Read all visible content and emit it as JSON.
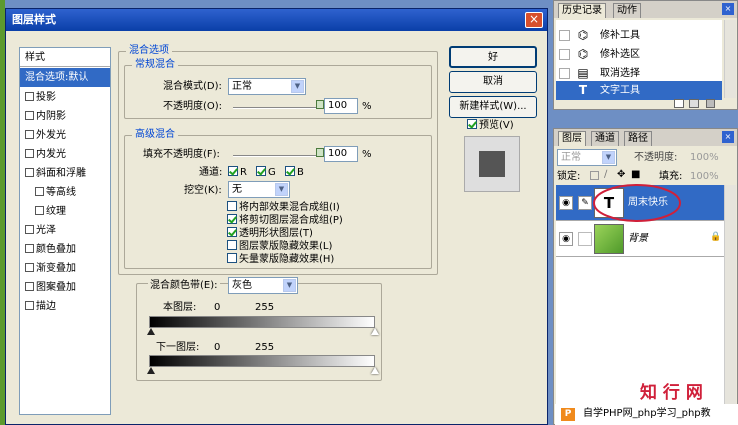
{
  "dialog": {
    "title": "图层样式",
    "close_glyph": "×",
    "style_list": {
      "header": "样式",
      "items": [
        {
          "label": "混合选项:默认",
          "selected": true,
          "checkbox": false
        },
        {
          "label": "投影",
          "checkbox": true
        },
        {
          "label": "内阴影",
          "checkbox": true
        },
        {
          "label": "外发光",
          "checkbox": true
        },
        {
          "label": "内发光",
          "checkbox": true
        },
        {
          "label": "斜面和浮雕",
          "checkbox": true
        },
        {
          "label": "等高线",
          "checkbox": true,
          "indent": true
        },
        {
          "label": "纹理",
          "checkbox": true,
          "indent": true
        },
        {
          "label": "光泽",
          "checkbox": true
        },
        {
          "label": "颜色叠加",
          "checkbox": true
        },
        {
          "label": "渐变叠加",
          "checkbox": true
        },
        {
          "label": "图案叠加",
          "checkbox": true
        },
        {
          "label": "描边",
          "checkbox": true
        }
      ]
    },
    "blend_options": {
      "group_title": "混合选项",
      "general": {
        "title": "常规混合",
        "blend_mode_label": "混合模式(D):",
        "blend_mode_value": "正常",
        "opacity_label": "不透明度(O):",
        "opacity_value": "100",
        "percent": "%"
      },
      "advanced": {
        "title": "高级混合",
        "fill_opacity_label": "填充不透明度(F):",
        "fill_opacity_value": "100",
        "percent": "%",
        "channels_label": "通道:",
        "channel_r": "R",
        "channel_g": "G",
        "channel_b": "B",
        "knockout_label": "挖空(K):",
        "knockout_value": "无",
        "options": [
          {
            "label": "将内部效果混合成组(I)",
            "checked": false
          },
          {
            "label": "将剪切图层混合成组(P)",
            "checked": true
          },
          {
            "label": "透明形状图层(T)",
            "checked": true
          },
          {
            "label": "图层蒙版隐藏效果(L)",
            "checked": false
          },
          {
            "label": "矢量蒙版隐藏效果(H)",
            "checked": false
          }
        ]
      },
      "blend_if": {
        "label": "混合颜色带(E):",
        "value": "灰色",
        "this_layer_label": "本图层:",
        "this_layer_min": "0",
        "this_layer_max": "255",
        "underlying_label": "下一图层:",
        "underlying_min": "0",
        "underlying_max": "255"
      }
    },
    "buttons": {
      "ok": "好",
      "cancel": "取消",
      "new_style": "新建样式(W)...",
      "preview_label": "预览(V)"
    }
  },
  "history_panel": {
    "tabs": [
      "历史记录",
      "动作"
    ],
    "items": [
      {
        "label": "修补工具",
        "icon": "patch-icon"
      },
      {
        "label": "修补选区",
        "icon": "patch-icon"
      },
      {
        "label": "取消选择",
        "icon": "document-icon"
      },
      {
        "label": "文字工具",
        "icon": "text-tool-icon",
        "selected": true
      }
    ]
  },
  "layers_panel": {
    "tabs": [
      "图层",
      "通道",
      "路径"
    ],
    "blend_mode": "正常",
    "opacity_label": "不透明度:",
    "opacity_value": "100%",
    "lock_label": "锁定:",
    "fill_label": "填充:",
    "fill_value": "100%",
    "layers": [
      {
        "name": "周末快乐",
        "type": "text",
        "thumb": "T",
        "selected": true
      },
      {
        "name": "背景",
        "type": "image",
        "locked": true
      }
    ]
  },
  "watermark": {
    "logo_text": "知 行 网",
    "footer_text": "自学PHP网_php学习_php教"
  },
  "colors": {
    "selection": "#316ac5",
    "titlebar": "#0a3fa8",
    "circle": "#d0203a"
  }
}
